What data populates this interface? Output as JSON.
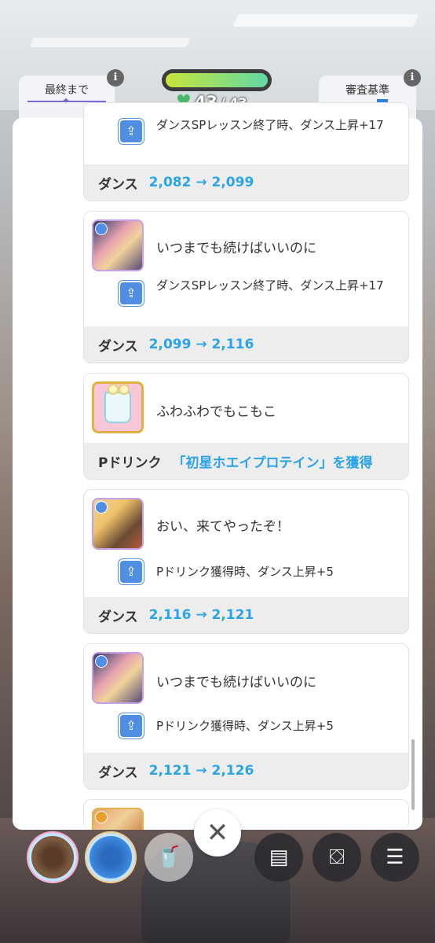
{
  "hud": {
    "left_label": "最終まで",
    "right_label": "審査基準",
    "stamina_current": "43",
    "stamina_sep_max": " / 43"
  },
  "cards": [
    {
      "effect": "ダンスSPレッスン終了時、ダンス上昇+17",
      "foot_label": "ダンス",
      "foot_value": "2,082 → 2,099"
    },
    {
      "title": "いつまでも続けばいいのに",
      "effect": "ダンスSPレッスン終了時、ダンス上昇+17",
      "foot_label": "ダンス",
      "foot_value": "2,099 → 2,116"
    },
    {
      "title": "ふわふわでもこもこ",
      "foot_label": "Pドリンク",
      "foot_value": "「初星ホエイプロテイン」を獲得"
    },
    {
      "title": "おい、来てやったぞ！",
      "effect": "Pドリンク獲得時、ダンス上昇+5",
      "foot_label": "ダンス",
      "foot_value": "2,116 → 2,121"
    },
    {
      "title": "いつまでも続けばいいのに",
      "effect": "Pドリンク獲得時、ダンス上昇+5",
      "foot_label": "ダンス",
      "foot_value": "2,121 → 2,126"
    }
  ],
  "close_label": "✕",
  "icons": {
    "effect": "dance-effect-icon",
    "info": "i",
    "cup": "empty-drink-slot-icon",
    "memo": "memo-icon",
    "gift": "gift-box-icon",
    "menu": "menu-icon"
  },
  "colors": {
    "accent_blue": "#2aa4e8",
    "effect_blue": "#4f8ee3",
    "stamina_green": "#47b86b"
  }
}
